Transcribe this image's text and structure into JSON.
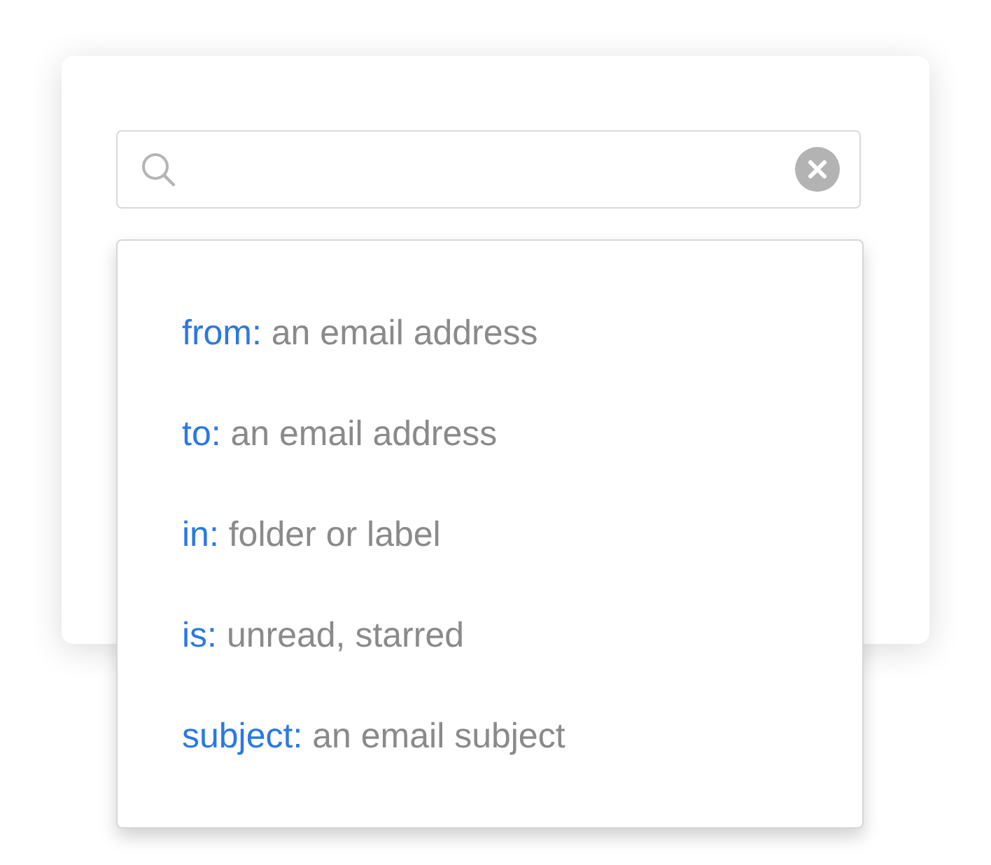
{
  "search": {
    "clearable": true
  },
  "suggestions": [
    {
      "key": "from:",
      "hint": "an email address"
    },
    {
      "key": "to:",
      "hint": "an email address"
    },
    {
      "key": "in:",
      "hint": "folder or label"
    },
    {
      "key": "is:",
      "hint": "unread, starred"
    },
    {
      "key": "subject:",
      "hint": "an email subject"
    }
  ]
}
